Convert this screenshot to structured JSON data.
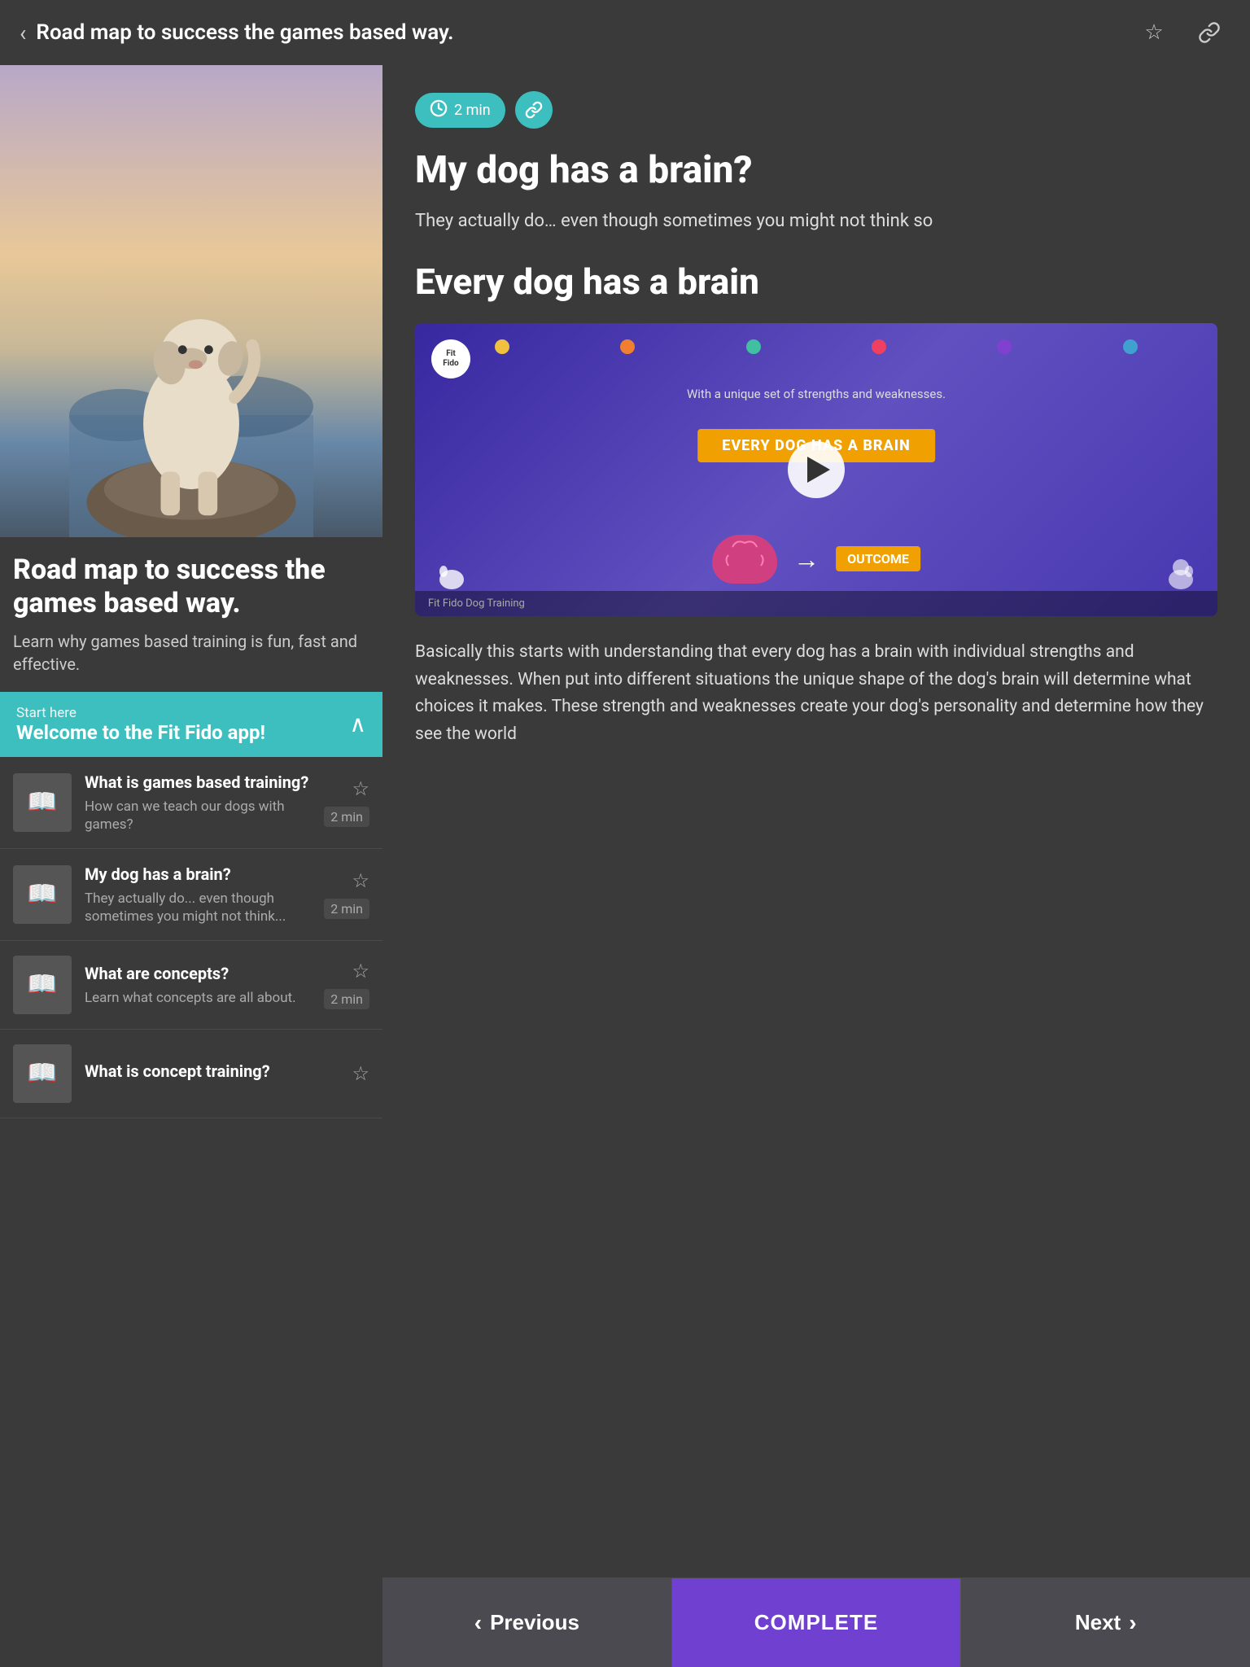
{
  "header": {
    "back_icon": "‹",
    "title": "Road map to success the games based way.",
    "bookmark_icon": "☆",
    "share_icon": "🔗"
  },
  "hero": {
    "alt": "Dog standing on rock at sunset"
  },
  "course": {
    "title": "Road map to success the games based way.",
    "description": "Learn why games based training is fun, fast and effective."
  },
  "start_here": {
    "label": "Start here",
    "title": "Welcome to the Fit Fido app!"
  },
  "lessons": [
    {
      "name": "What is games based training?",
      "desc": "How can we teach our dogs with games?",
      "duration": "2 min"
    },
    {
      "name": "My dog has a brain?",
      "desc": "They actually do... even though sometimes you might not think...",
      "duration": "2 min"
    },
    {
      "name": "What are concepts?",
      "desc": "Learn what concepts are all about.",
      "duration": "2 min"
    },
    {
      "name": "What is concept training?",
      "desc": "",
      "duration": ""
    }
  ],
  "content": {
    "duration_badge": "2 min",
    "duration_icon": "🕐",
    "link_icon": "🔗",
    "main_title": "My dog has a brain?",
    "main_subtitle": "They actually do… even though sometimes you might not think so",
    "section_title": "Every dog has a brain",
    "video": {
      "title": "EVERY DOG HAS A BRAIN",
      "subtitle": "With a unique set of strengths and weaknesses.",
      "caption": "Fit Fido Dog Training",
      "outcome_label": "OUTCOME"
    },
    "body_text": "Basically this starts with understanding that every dog has a brain with individual strengths and weaknesses. When put into different situations the unique shape of the dog's brain will determine what choices it makes. These strength and weaknesses create your dog's personality and determine how they see the world"
  },
  "bottom_nav": {
    "previous_label": "Previous",
    "complete_label": "COMPLETE",
    "next_label": "Next",
    "prev_arrow": "‹",
    "next_arrow": "›"
  }
}
